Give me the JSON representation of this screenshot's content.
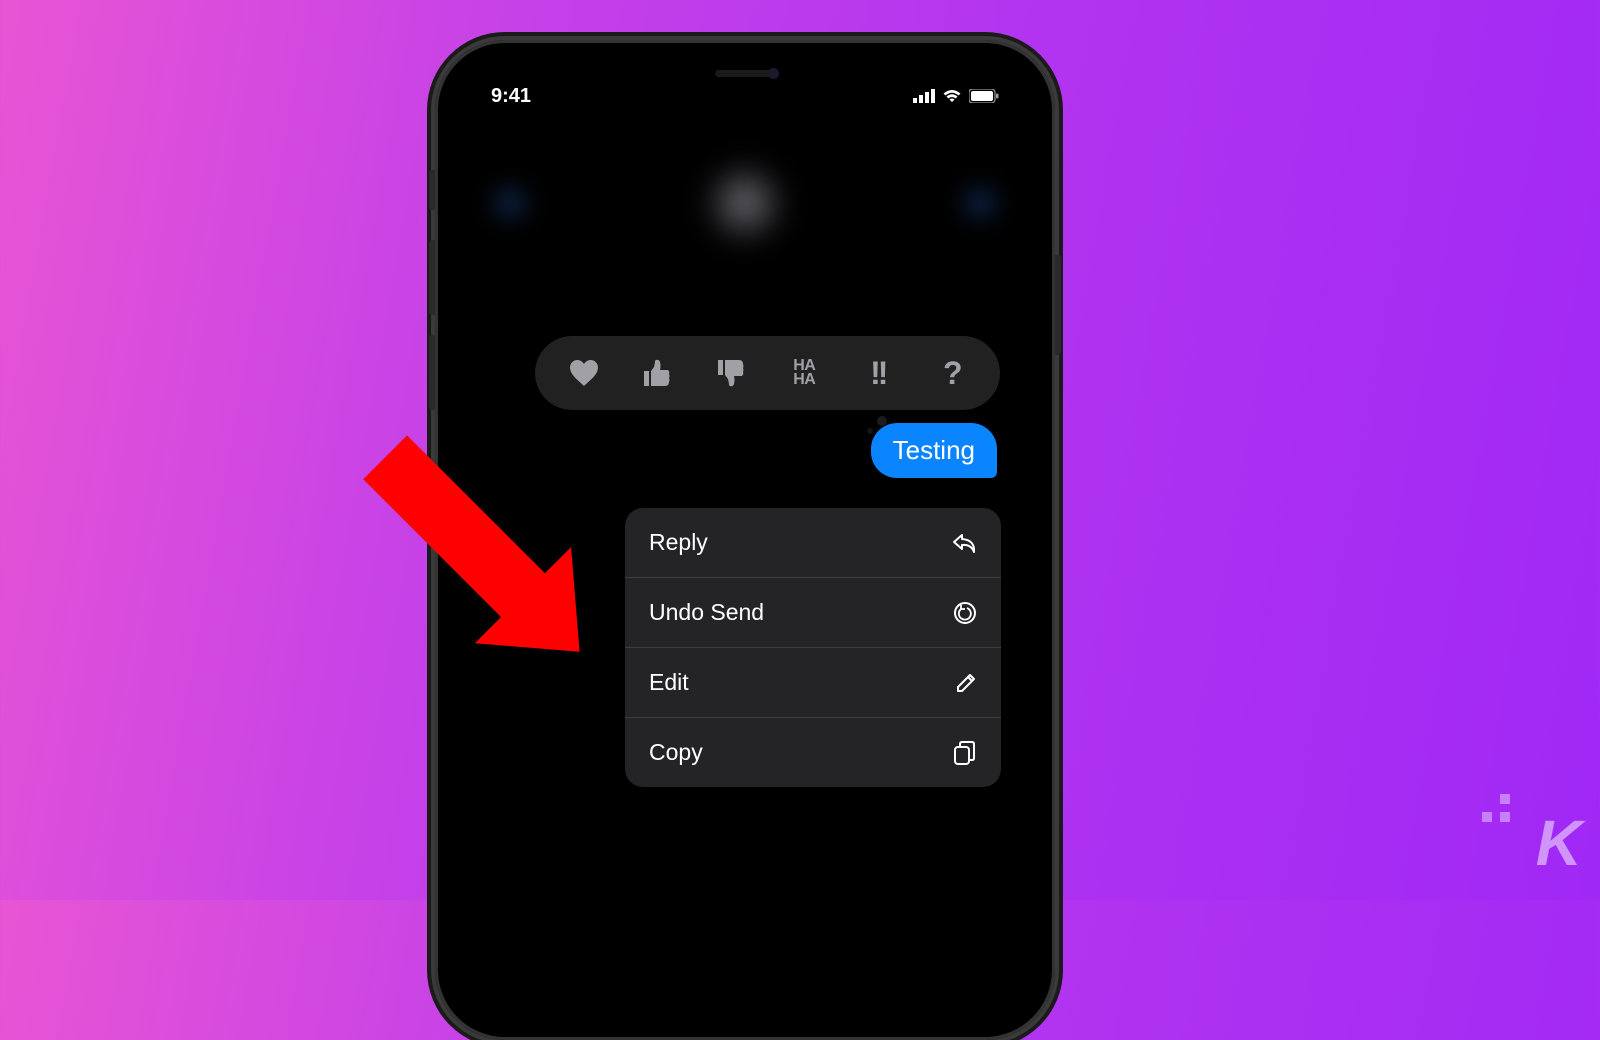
{
  "status": {
    "time": "9:41"
  },
  "message": {
    "text": "Testing"
  },
  "tapback": {
    "haha_line1": "HA",
    "haha_line2": "HA",
    "exclaim": "!!",
    "question": "?"
  },
  "menu": {
    "reply": "Reply",
    "undo_send": "Undo Send",
    "edit": "Edit",
    "copy": "Copy"
  },
  "watermark": "K"
}
